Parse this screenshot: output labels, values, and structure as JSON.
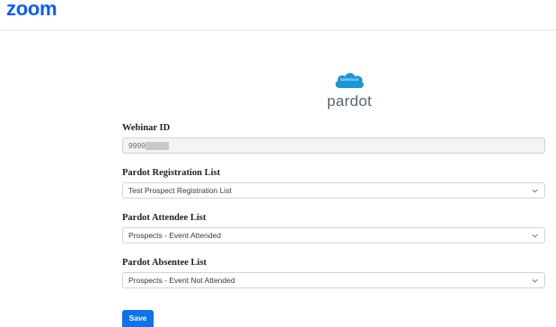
{
  "header": {
    "logo_text": "zoom",
    "logo_color": "#0b5cff"
  },
  "brand": {
    "cloud_text": "salesforce",
    "product_name": "pardot",
    "cloud_color": "#1b96d6"
  },
  "form": {
    "webinar_id": {
      "label": "Webinar ID",
      "value": "9999"
    },
    "registration_list": {
      "label": "Pardot Registration List",
      "selected": "Test Prospect Registration List"
    },
    "attendee_list": {
      "label": "Pardot Attendee List",
      "selected": "Prospects - Event Attended"
    },
    "absentee_list": {
      "label": "Pardot Absentee List",
      "selected": "Prospects - Event Not Attended"
    },
    "save_label": "Save"
  },
  "colors": {
    "accent": "#0e72ed"
  },
  "icons": {
    "dropdown": "chevron-down-icon"
  }
}
